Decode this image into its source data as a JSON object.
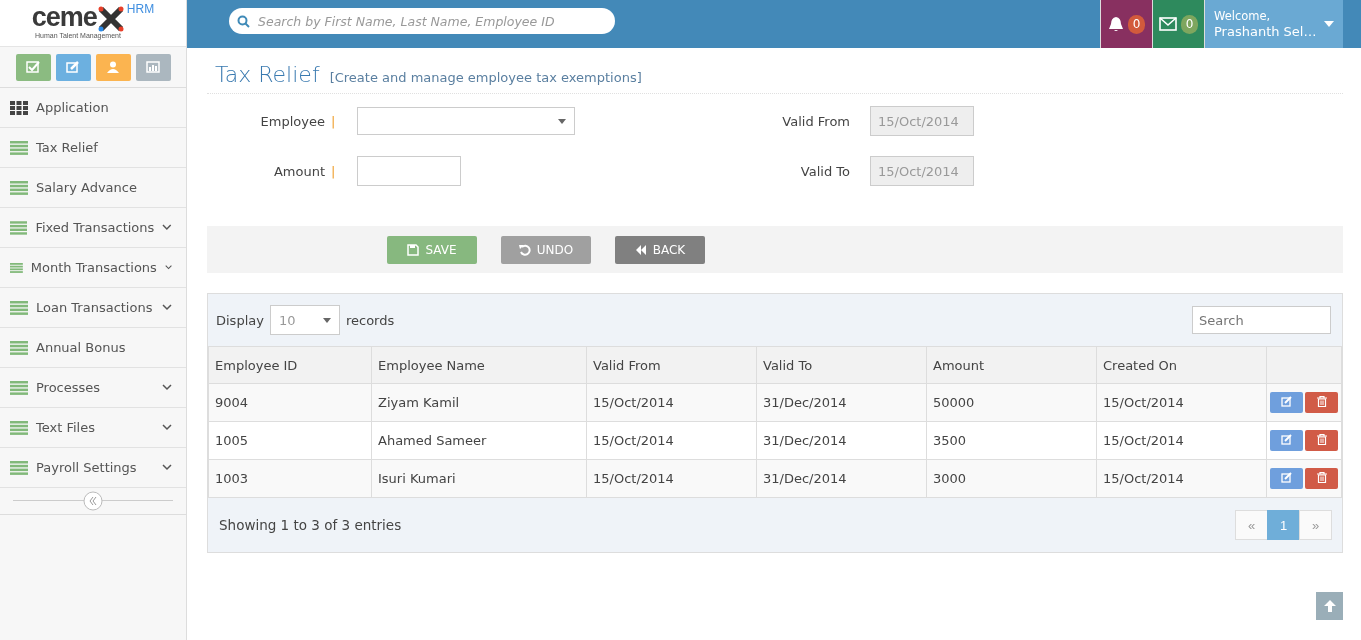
{
  "logo": {
    "text": "ceme",
    "badge": "HRM",
    "tagline": "Human Talent Management"
  },
  "quick_buttons": [
    {
      "kind": "check",
      "color": "#8bbb81"
    },
    {
      "kind": "edit",
      "color": "#6cb0e0"
    },
    {
      "kind": "user",
      "color": "#fbb450"
    },
    {
      "kind": "chart",
      "color": "#abb7bf"
    }
  ],
  "sidebar": {
    "items": [
      {
        "label": "Application",
        "kind": "grid",
        "expandable": false
      },
      {
        "label": "Tax Relief",
        "kind": "list",
        "expandable": false
      },
      {
        "label": "Salary Advance",
        "kind": "list",
        "expandable": false
      },
      {
        "label": "Fixed Transactions",
        "kind": "list",
        "expandable": true
      },
      {
        "label": "Month Transactions",
        "kind": "list",
        "expandable": true
      },
      {
        "label": "Loan Transactions",
        "kind": "list",
        "expandable": true
      },
      {
        "label": "Annual Bonus",
        "kind": "list",
        "expandable": false
      },
      {
        "label": "Processes",
        "kind": "list",
        "expandable": true
      },
      {
        "label": "Text Files",
        "kind": "list",
        "expandable": true
      },
      {
        "label": "Payroll Settings",
        "kind": "list",
        "expandable": true
      }
    ]
  },
  "topbar": {
    "search": {
      "placeholder": "Search by First Name, Last Name, Employee ID"
    },
    "notifications": "0",
    "messages": "0",
    "welcome": "Welcome,",
    "user": "Prashanth Sel…"
  },
  "page": {
    "title": "Tax Relief",
    "subtitle": "[Create and manage employee tax exemptions]"
  },
  "form": {
    "employee": {
      "label": "Employee",
      "marker": "|"
    },
    "amount": {
      "label": "Amount",
      "marker": "|"
    },
    "valid_from": {
      "label": "Valid From",
      "value": "15/Oct/2014"
    },
    "valid_to": {
      "label": "Valid To",
      "value": "15/Oct/2014"
    }
  },
  "buttons": [
    {
      "kind": "save",
      "label": "SAVE"
    },
    {
      "kind": "undo",
      "label": "UNDO"
    },
    {
      "kind": "back",
      "label": "BACK"
    }
  ],
  "table": {
    "display_label": "Display",
    "page_size": "10",
    "records_label": "records",
    "search_placeholder": "Search",
    "columns": [
      "Employee ID",
      "Employee Name",
      "Valid From",
      "Valid To",
      "Amount",
      "Created On"
    ],
    "rows": [
      [
        "9004",
        "Ziyam Kamil",
        "15/Oct/2014",
        "31/Dec/2014",
        "50000",
        "15/Oct/2014"
      ],
      [
        "1005",
        "Ahamed Sameer",
        "15/Oct/2014",
        "31/Dec/2014",
        "3500",
        "15/Oct/2014"
      ],
      [
        "1003",
        "Isuri Kumari",
        "15/Oct/2014",
        "31/Dec/2014",
        "3000",
        "15/Oct/2014"
      ]
    ],
    "info": "Showing 1 to 3 of 3 entries",
    "pagination": [
      {
        "label": "«",
        "selected": false
      },
      {
        "label": "1",
        "selected": true
      },
      {
        "label": "»",
        "selected": false
      }
    ]
  }
}
